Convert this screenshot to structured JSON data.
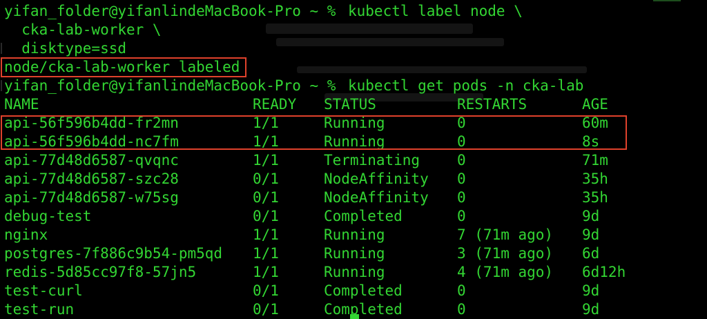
{
  "terminal": {
    "command1": {
      "prompt": "yifan_folder@yifanlindeMacBook-Pro ~ % ",
      "lines": [
        "kubectl label node \\",
        "  cka-lab-worker \\",
        "  disktype=ssd"
      ]
    },
    "output1": "node/cka-lab-worker labeled",
    "command2": {
      "prompt": "yifan_folder@yifanlindeMacBook-Pro ~ % ",
      "text": "kubectl get pods -n cka-lab"
    },
    "table": {
      "headers": [
        "NAME",
        "READY",
        "STATUS",
        "RESTARTS",
        "AGE"
      ],
      "rows": [
        [
          "api-56f596b4dd-fr2mn",
          "1/1",
          "Running",
          "0",
          "60m"
        ],
        [
          "api-56f596b4dd-nc7fm",
          "1/1",
          "Running",
          "0",
          "8s"
        ],
        [
          "api-77d48d6587-qvqnc",
          "1/1",
          "Terminating",
          "0",
          "71m"
        ],
        [
          "api-77d48d6587-szc28",
          "0/1",
          "NodeAffinity",
          "0",
          "35h"
        ],
        [
          "api-77d48d6587-w75sg",
          "0/1",
          "NodeAffinity",
          "0",
          "35h"
        ],
        [
          "debug-test",
          "0/1",
          "Completed",
          "0",
          "9d"
        ],
        [
          "nginx",
          "1/1",
          "Running",
          "7 (71m ago)",
          "9d"
        ],
        [
          "postgres-7f886c9b54-pm5qd",
          "1/1",
          "Running",
          "3 (71m ago)",
          "6d"
        ],
        [
          "redis-5d85cc97f8-57jn5",
          "1/1",
          "Running",
          "4 (71m ago)",
          "6d12h"
        ],
        [
          "test-curl",
          "0/1",
          "Completed",
          "0",
          "9d"
        ],
        [
          "test-run",
          "0/1",
          "Completed",
          "0",
          "9d"
        ]
      ]
    },
    "colors": {
      "background": "#000000",
      "text": "#33d633",
      "highlight": "#e0422c"
    }
  }
}
